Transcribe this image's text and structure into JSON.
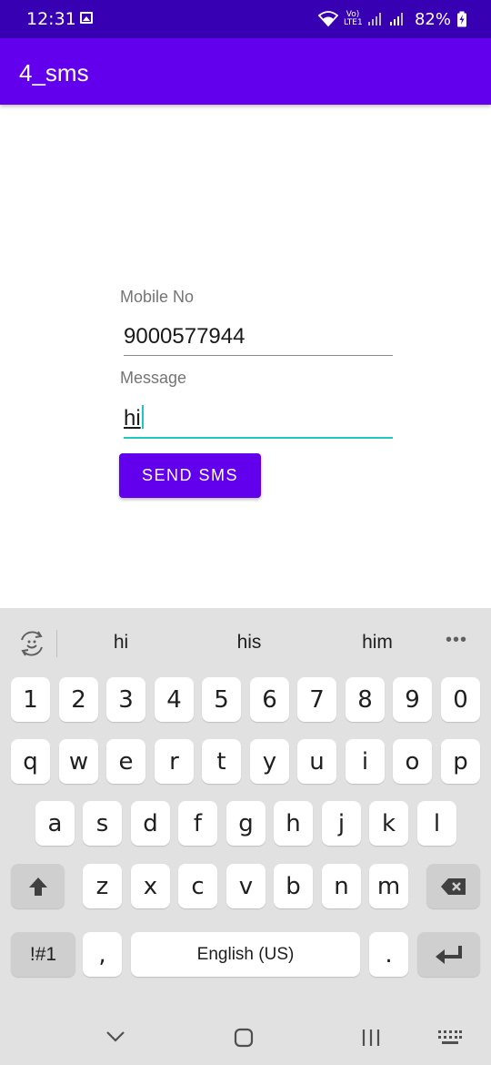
{
  "status_bar": {
    "time": "12:31",
    "signal_label": "Vo) LTE1",
    "battery_percent": "82%"
  },
  "app_bar": {
    "title": "4_sms"
  },
  "form": {
    "mobile_label": "Mobile No",
    "mobile_value": "9000577944",
    "message_label": "Message",
    "message_value": "hi",
    "send_button_label": "SEND SMS"
  },
  "keyboard": {
    "suggestions": [
      "hi",
      "his",
      "him"
    ],
    "more_label": "•••",
    "row_numbers": [
      "1",
      "2",
      "3",
      "4",
      "5",
      "6",
      "7",
      "8",
      "9",
      "0"
    ],
    "row_top": [
      "q",
      "w",
      "e",
      "r",
      "t",
      "y",
      "u",
      "i",
      "o",
      "p"
    ],
    "row_middle": [
      "a",
      "s",
      "d",
      "f",
      "g",
      "h",
      "j",
      "k",
      "l"
    ],
    "row_bottom": [
      "z",
      "x",
      "c",
      "v",
      "b",
      "n",
      "m"
    ],
    "symbols_label": "!#1",
    "comma_label": ",",
    "space_label": "English (US)",
    "period_label": "."
  },
  "colors": {
    "status_bar": "#3700B3",
    "primary": "#6200EE",
    "accent": "#1ec8c0",
    "keyboard_bg": "#e1e1e1"
  },
  "icons": {
    "status": [
      "gallery-icon",
      "wifi-icon",
      "signal-icon",
      "battery-charging-icon"
    ],
    "keyboard": [
      "emoji-icon",
      "shift-icon",
      "backspace-icon",
      "enter-icon"
    ],
    "nav": [
      "collapse-keyboard-icon",
      "home-icon",
      "recents-icon",
      "keyboard-switch-icon"
    ]
  }
}
